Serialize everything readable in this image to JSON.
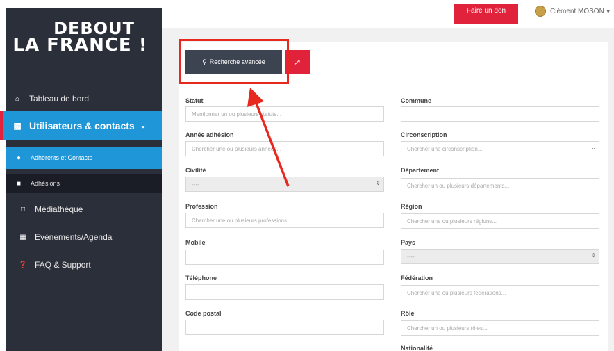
{
  "logo": {
    "line1": "DEBOUT",
    "line2": "LA FRANCE !"
  },
  "sidebar": {
    "items": [
      {
        "label": "Tableau de bord",
        "icon": "home-icon"
      },
      {
        "label": "Utilisateurs & contacts",
        "icon": "users-icon"
      },
      {
        "label": "Adhérents et Contacts",
        "icon": "people-icon"
      },
      {
        "label": "Adhésions",
        "icon": "list-icon"
      },
      {
        "label": "Médiathèque",
        "icon": "media-icon"
      },
      {
        "label": "Evènements/Agenda",
        "icon": "calendar-icon"
      },
      {
        "label": "FAQ & Support",
        "icon": "help-icon"
      }
    ]
  },
  "topbar": {
    "donate_label": "Faire un don",
    "user_name": "Clément MOSON"
  },
  "toolbar": {
    "search_label": "Recherche avancée"
  },
  "colors": {
    "accent_red": "#e0223a",
    "accent_blue": "#1f96d8",
    "sidebar_bg": "#2b2f3a",
    "highlight": "#e8281e"
  },
  "form": {
    "left": [
      {
        "label": "Statut",
        "placeholder": "Mentionner un ou plusieurs statuts..."
      },
      {
        "label": "Année adhésion",
        "placeholder": "Chercher une ou plusieurs années..."
      },
      {
        "label": "Civilité",
        "placeholder": "----"
      },
      {
        "label": "Profession",
        "placeholder": "Chercher une ou plusieurs professions..."
      },
      {
        "label": "Mobile",
        "placeholder": ""
      },
      {
        "label": "Téléphone",
        "placeholder": ""
      },
      {
        "label": "Code postal",
        "placeholder": ""
      }
    ],
    "right": [
      {
        "label": "Commune",
        "placeholder": ""
      },
      {
        "label": "Circonscription",
        "placeholder": "Chercher une circonscription..."
      },
      {
        "label": "Département",
        "placeholder": "Chercher un ou plusieurs départements..."
      },
      {
        "label": "Région",
        "placeholder": "Chercher une ou plusieurs régions..."
      },
      {
        "label": "Pays",
        "placeholder": "----"
      },
      {
        "label": "Fédération",
        "placeholder": "Chercher une ou plusieurs fédérations..."
      },
      {
        "label": "Rôle",
        "placeholder": "Chercher un ou plusieurs rôles..."
      },
      {
        "label": "Nationalité",
        "placeholder": ""
      }
    ]
  }
}
